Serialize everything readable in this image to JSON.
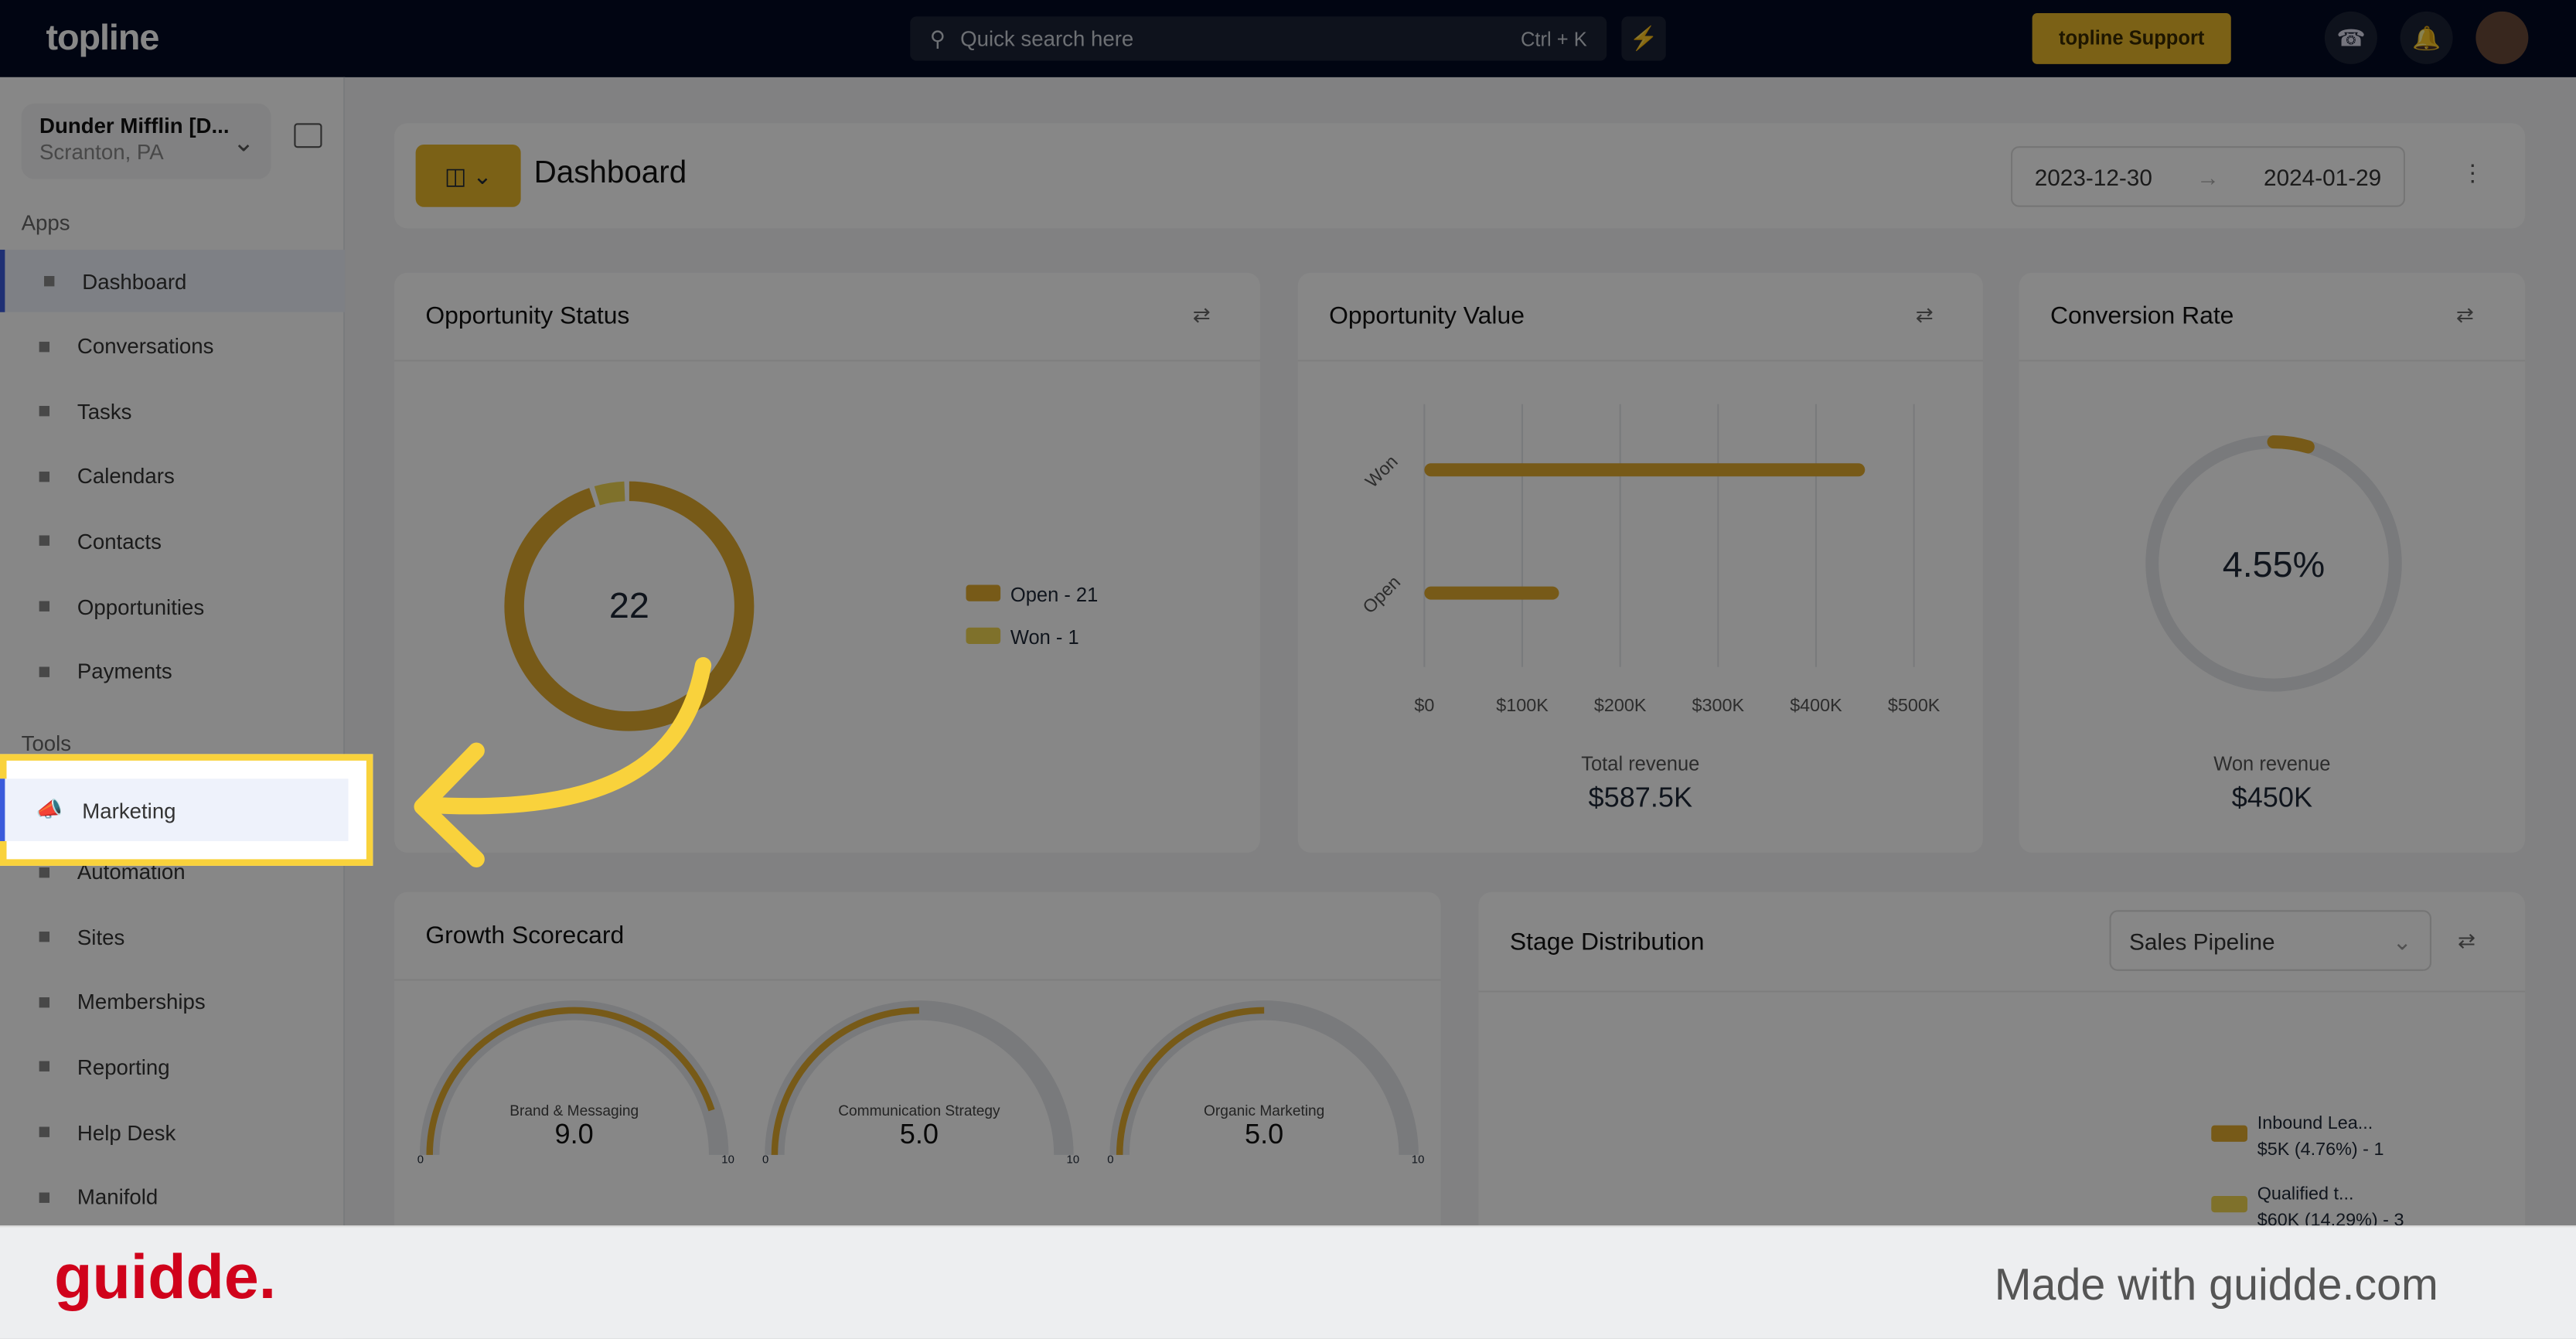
{
  "topbar": {
    "logo": "topline",
    "search_placeholder": "Quick search here",
    "search_shortcut": "Ctrl + K",
    "support_label": "topline Support"
  },
  "sidebar": {
    "account_name": "Dunder Mifflin [D...",
    "account_location": "Scranton, PA",
    "apps_label": "Apps",
    "tools_label": "Tools",
    "apps": [
      {
        "label": "Dashboard",
        "icon": "dashboard-icon"
      },
      {
        "label": "Conversations",
        "icon": "chat-icon"
      },
      {
        "label": "Tasks",
        "icon": "task-icon"
      },
      {
        "label": "Calendars",
        "icon": "calendar-icon"
      },
      {
        "label": "Contacts",
        "icon": "user-icon"
      },
      {
        "label": "Opportunities",
        "icon": "target-icon"
      },
      {
        "label": "Payments",
        "icon": "card-icon"
      }
    ],
    "tools": [
      {
        "label": "Marketing",
        "icon": "megaphone-icon"
      },
      {
        "label": "Automation",
        "icon": "automation-icon"
      },
      {
        "label": "Sites",
        "icon": "globe-icon"
      },
      {
        "label": "Memberships",
        "icon": "members-icon"
      },
      {
        "label": "Reporting",
        "icon": "pie-icon"
      },
      {
        "label": "Help Desk",
        "icon": "help-icon"
      },
      {
        "label": "Manifold",
        "icon": "manifold-icon"
      }
    ]
  },
  "header": {
    "title": "Dashboard",
    "date_from": "2023-12-30",
    "date_to": "2024-01-29"
  },
  "cards": {
    "opp_status": {
      "title": "Opportunity Status",
      "total": "22",
      "legend": [
        "Open - 21",
        "Won - 1"
      ]
    },
    "opp_value": {
      "title": "Opportunity Value",
      "total_label": "Total revenue",
      "total": "$587.5K"
    },
    "conversion": {
      "title": "Conversion Rate",
      "value": "4.55%",
      "won_label": "Won revenue",
      "won": "$450K"
    },
    "growth": {
      "title": "Growth Scorecard",
      "gauges": [
        {
          "name": "Brand & Messaging",
          "value": "9.0",
          "min": "0",
          "max": "10"
        },
        {
          "name": "Communication Strategy",
          "value": "5.0",
          "min": "0",
          "max": "10"
        },
        {
          "name": "Organic Marketing",
          "value": "5.0",
          "min": "0",
          "max": "10"
        }
      ]
    },
    "stage": {
      "title": "Stage Distribution",
      "pipeline": "Sales Pipeline",
      "legend": [
        {
          "name": "Inbound Lea...",
          "detail": "$5K (4.76%) - 1"
        },
        {
          "name": "Qualified t...",
          "detail": "$60K (14.29%) - 3"
        }
      ]
    }
  },
  "colors": {
    "accent": "#e8b82a",
    "open": "#e0aa2e",
    "won": "#f0d552",
    "highlight": "#f9d23c"
  },
  "chart_data": [
    {
      "type": "pie",
      "title": "Opportunity Status",
      "categories": [
        "Open",
        "Won"
      ],
      "values": [
        21,
        1
      ]
    },
    {
      "type": "bar",
      "orientation": "horizontal",
      "title": "Opportunity Value",
      "categories": [
        "Won",
        "Open"
      ],
      "values": [
        450000,
        137500
      ],
      "ticks": [
        "$0",
        "$100K",
        "$200K",
        "$300K",
        "$400K",
        "$500K"
      ],
      "xlim": [
        0,
        500000
      ],
      "grid": true
    }
  ],
  "footer": {
    "brand": "guidde.",
    "tagline": "Made with guidde.com"
  }
}
